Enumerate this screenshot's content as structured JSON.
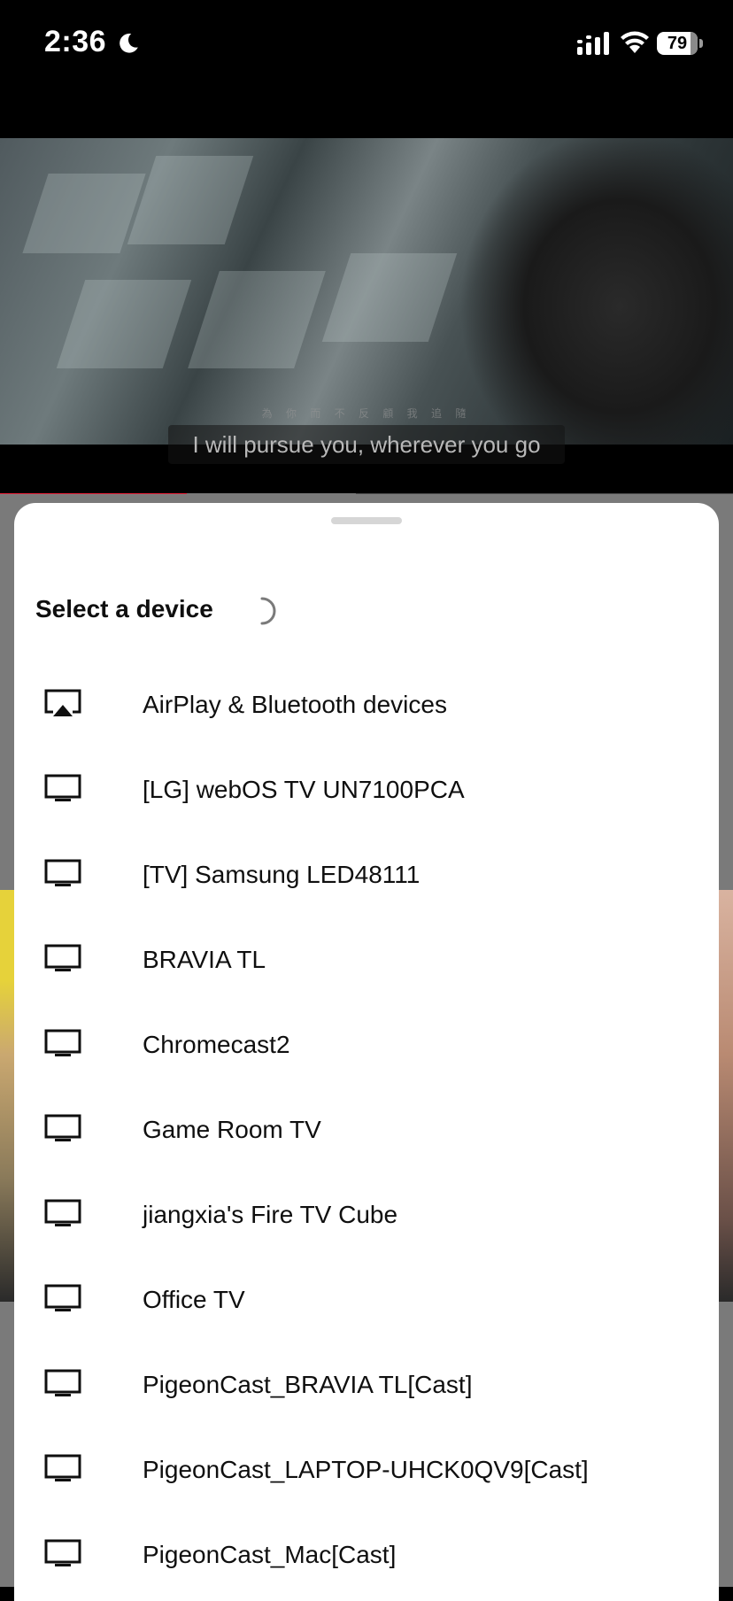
{
  "status_bar": {
    "time": "2:36",
    "battery": "79",
    "icons": [
      "moon-icon",
      "signal-icon",
      "wifi-icon",
      "battery-icon"
    ]
  },
  "video": {
    "subtitle_cn": "為 你 而 不 反 顧 我 追 隨",
    "subtitle": "I will pursue you, wherever you go",
    "progress_played_fraction": 0.255,
    "progress_buffered_fraction": 0.485,
    "progress_color": "#e8213a"
  },
  "sheet": {
    "title": "Select a device",
    "loading": true,
    "devices": [
      {
        "label": "AirPlay & Bluetooth devices",
        "icon": "airplay-icon"
      },
      {
        "label": "[LG] webOS TV UN7100PCA",
        "icon": "tv-icon"
      },
      {
        "label": "[TV] Samsung LED48111",
        "icon": "tv-icon"
      },
      {
        "label": "BRAVIA TL",
        "icon": "tv-icon"
      },
      {
        "label": "Chromecast2",
        "icon": "tv-icon"
      },
      {
        "label": "Game Room TV",
        "icon": "tv-icon"
      },
      {
        "label": "jiangxia's Fire TV Cube",
        "icon": "tv-icon"
      },
      {
        "label": "Office TV",
        "icon": "tv-icon"
      },
      {
        "label": "PigeonCast_BRAVIA TL[Cast]",
        "icon": "tv-icon"
      },
      {
        "label": "PigeonCast_LAPTOP-UHCK0QV9[Cast]",
        "icon": "tv-icon"
      },
      {
        "label": "PigeonCast_Mac[Cast]",
        "icon": "tv-icon"
      }
    ]
  }
}
